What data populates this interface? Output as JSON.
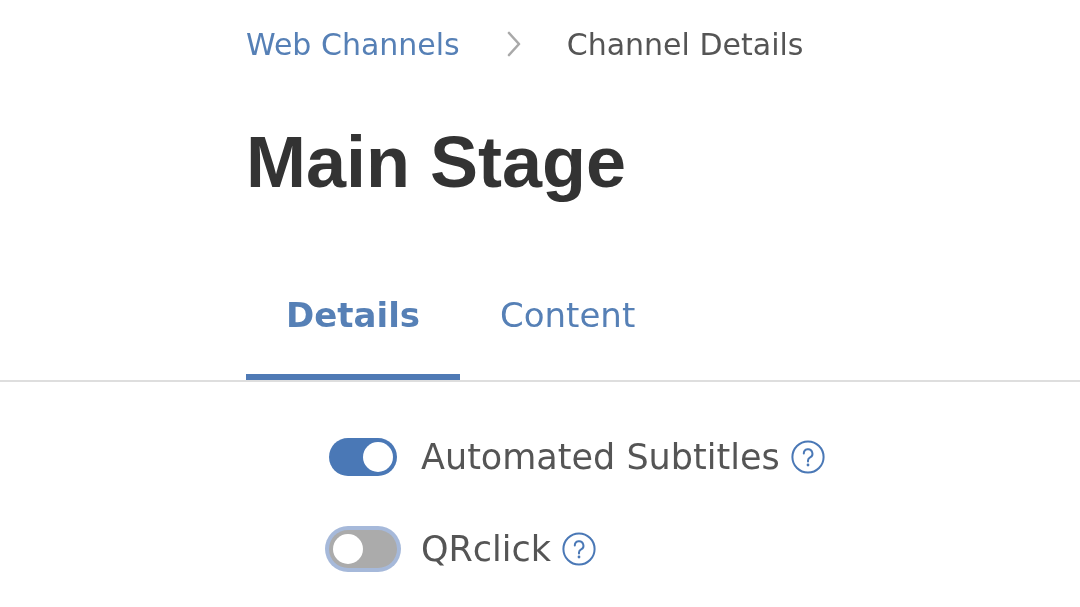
{
  "breadcrumb": [
    {
      "label": "Web Channels",
      "kind": "link"
    },
    {
      "label": "Channel Details",
      "kind": "current"
    }
  ],
  "title": "Main Stage",
  "tabs": [
    {
      "label": "Details",
      "selected": true
    },
    {
      "label": "Content",
      "selected": false
    }
  ],
  "settings": [
    {
      "label": "Automated Subtitles",
      "on": true,
      "focused": false,
      "help": true
    },
    {
      "label": "QRclick",
      "on": false,
      "focused": true,
      "help": true
    }
  ]
}
